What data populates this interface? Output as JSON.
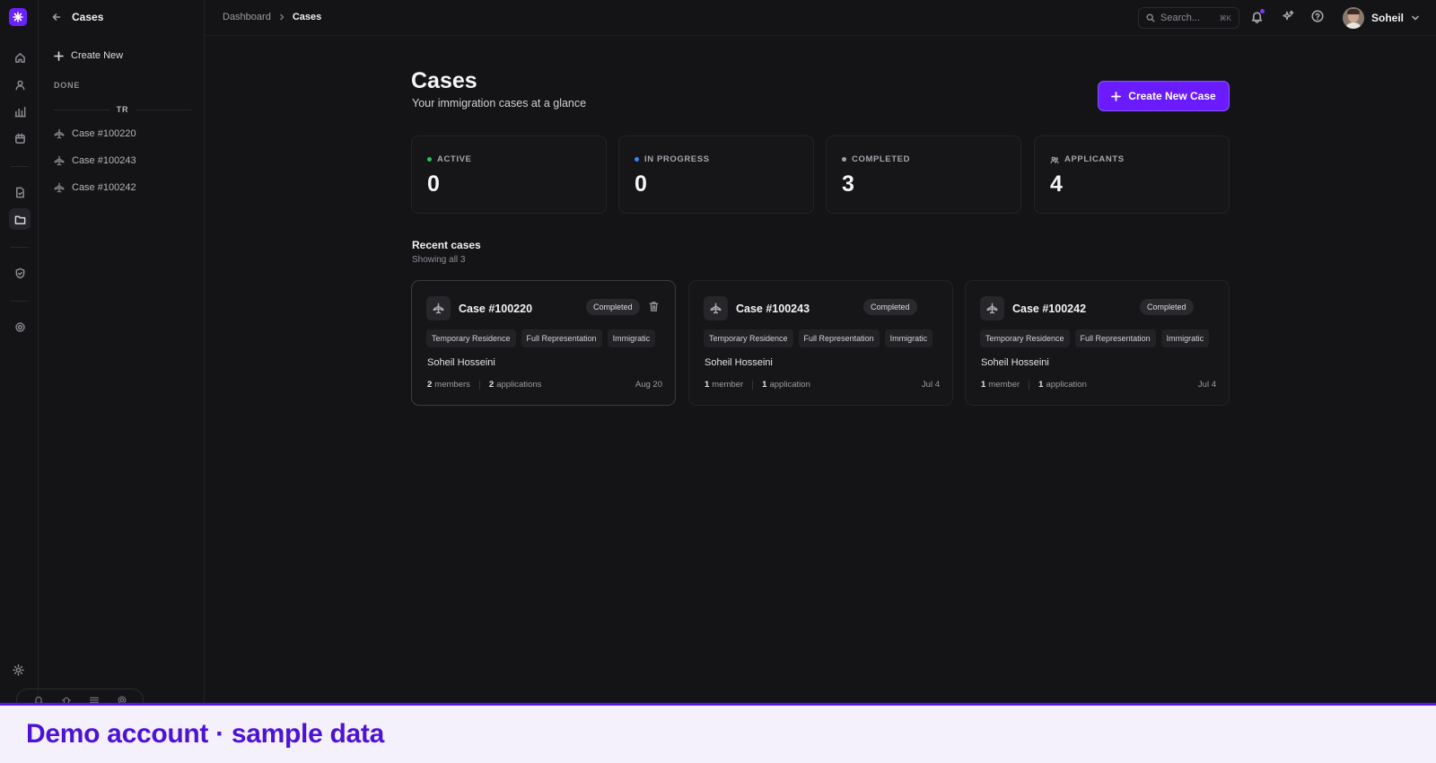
{
  "sidebar": {
    "title": "Cases",
    "create_label": "Create New",
    "section_label": "DONE",
    "group_label": "TR",
    "items": [
      {
        "label": "Case #100220"
      },
      {
        "label": "Case #100243"
      },
      {
        "label": "Case #100242"
      }
    ]
  },
  "topbar": {
    "breadcrumb": [
      "Dashboard",
      "Cases"
    ],
    "search_placeholder": "Search...",
    "search_shortcut": "⌘K",
    "user_name": "Soheil"
  },
  "main": {
    "title": "Cases",
    "subtitle": "Your immigration cases at a glance",
    "create_button": "Create New Case",
    "stats": [
      {
        "label": "ACTIVE",
        "value": "0",
        "color": "#22c55e"
      },
      {
        "label": "IN PROGRESS",
        "value": "0",
        "color": "#3b82f6"
      },
      {
        "label": "COMPLETED",
        "value": "3",
        "color": "#9ca3af"
      },
      {
        "label": "APPLICANTS",
        "value": "4",
        "icon": "users-icon"
      }
    ],
    "recent_title": "Recent cases",
    "recent_sub": "Showing all 3",
    "cards": [
      {
        "id": "Case #100220",
        "status": "Completed",
        "tags": [
          "Temporary Residence",
          "Full Representation",
          "Immigratic"
        ],
        "owner": "Soheil Hosseini",
        "members_count": "2",
        "members_label": "members",
        "apps_count": "2",
        "apps_label": "applications",
        "date": "Aug 20"
      },
      {
        "id": "Case #100243",
        "status": "Completed",
        "tags": [
          "Temporary Residence",
          "Full Representation",
          "Immigratic"
        ],
        "owner": "Soheil Hosseini",
        "members_count": "1",
        "members_label": "member",
        "apps_count": "1",
        "apps_label": "application",
        "date": "Jul 4"
      },
      {
        "id": "Case #100242",
        "status": "Completed",
        "tags": [
          "Temporary Residence",
          "Full Representation",
          "Immigratic"
        ],
        "owner": "Soheil Hosseini",
        "members_count": "1",
        "members_label": "member",
        "apps_count": "1",
        "apps_label": "application",
        "date": "Jul 4"
      }
    ]
  },
  "banner": {
    "text": "Demo account · sample data"
  },
  "colors": {
    "accent": "#6a1bff",
    "background": "#141417",
    "banner_text": "#4d12d6"
  }
}
